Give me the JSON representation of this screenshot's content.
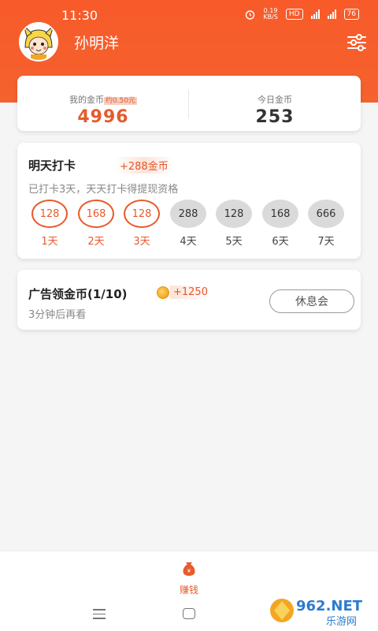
{
  "status_bar": {
    "time": "11:30",
    "speed_top": "0.19",
    "speed_unit": "KB/S",
    "hd": "HD",
    "battery": "76",
    "icons": [
      "alarm-icon",
      "hd-icon",
      "signal-4g-icon",
      "signal-4g-icon",
      "battery-icon"
    ]
  },
  "profile": {
    "name": "孙明洋",
    "avatar": "pikachu-hood-avatar"
  },
  "coins": {
    "my_label": "我的金币",
    "approx_tag": "约0.50元",
    "my_value": "4996",
    "today_label": "今日金币",
    "today_value": "253"
  },
  "checkin": {
    "title": "明天打卡",
    "reward": "+288金币",
    "subtitle": "已打卡3天，天天打卡得提现资格",
    "days": [
      {
        "value": "128",
        "label": "1天",
        "done": true
      },
      {
        "value": "168",
        "label": "2天",
        "done": true
      },
      {
        "value": "128",
        "label": "3天",
        "done": true
      },
      {
        "value": "288",
        "label": "4天",
        "done": false
      },
      {
        "value": "128",
        "label": "5天",
        "done": false
      },
      {
        "value": "168",
        "label": "6天",
        "done": false
      },
      {
        "value": "666",
        "label": "7天",
        "done": false
      }
    ]
  },
  "ad": {
    "title": "广告领金币(1/10)",
    "reward": "+1250",
    "subtitle": "3分钟后再看",
    "button": "休息会"
  },
  "tab_bar": {
    "earn_label": "赚钱"
  },
  "watermark": {
    "text_top": "962.NET",
    "text_bottom": "乐游网"
  },
  "colors": {
    "brand": "#f4622e",
    "accent": "#e95a2c",
    "inactive_circle": "#dadada"
  }
}
